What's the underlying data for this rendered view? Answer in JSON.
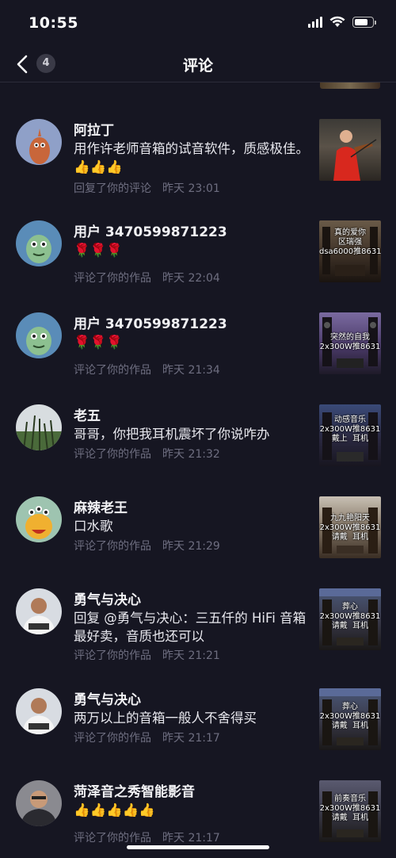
{
  "status": {
    "time": "10:55"
  },
  "nav": {
    "back_count": "4",
    "title": "评论"
  },
  "items": [
    {
      "name": "阿拉丁",
      "content": "用作许老师音箱的试音软件，质感极佳。👍👍👍",
      "action": "回复了你的评论",
      "time": "昨天 23:01",
      "thumb_text": ""
    },
    {
      "name": "用户 3470599871223",
      "content": "🌹🌹🌹",
      "action": "评论了你的作品",
      "time": "昨天 22:04",
      "thumb_text": "真的爱你\n区瑞强\ndsa6000推8631"
    },
    {
      "name": "用户 3470599871223",
      "content": "🌹🌹🌹",
      "action": "评论了你的作品",
      "time": "昨天 21:34",
      "thumb_text": "突然的自我\n2x300W推8631"
    },
    {
      "name": "老五",
      "content": "哥哥，你把我耳机震坏了你说咋办",
      "action": "评论了你的作品",
      "time": "昨天 21:32",
      "thumb_text": "动感音乐\n2x300W推8631\n戴上  耳机"
    },
    {
      "name": "麻辣老王",
      "content": "口水歌",
      "action": "评论了你的作品",
      "time": "昨天 21:29",
      "thumb_text": "九九艳阳天\n2x300W推8631\n请戴  耳机"
    },
    {
      "name": "勇气与决心",
      "content": "回复 @勇气与决心：三五仟的 HiFi 音箱最好卖，音质也还可以",
      "action": "评论了你的作品",
      "time": "昨天 21:21",
      "thumb_text": "葬心\n2x300W推8631\n请戴  耳机"
    },
    {
      "name": "勇气与决心",
      "content": "两万以上的音箱一般人不舍得买",
      "action": "评论了你的作品",
      "time": "昨天 21:17",
      "thumb_text": "葬心\n2x300W推8631\n请戴  耳机"
    },
    {
      "name": "菏泽音之秀智能影音",
      "content": "👍👍👍👍👍",
      "action": "评论了你的作品",
      "time": "昨天 21:17",
      "thumb_text": "前奏音乐\n2x300W推8631\n请戴  耳机"
    }
  ],
  "icons": {
    "back": "chevron-left-icon",
    "signal": "cellular-signal-icon",
    "wifi": "wifi-icon",
    "battery": "battery-icon"
  }
}
